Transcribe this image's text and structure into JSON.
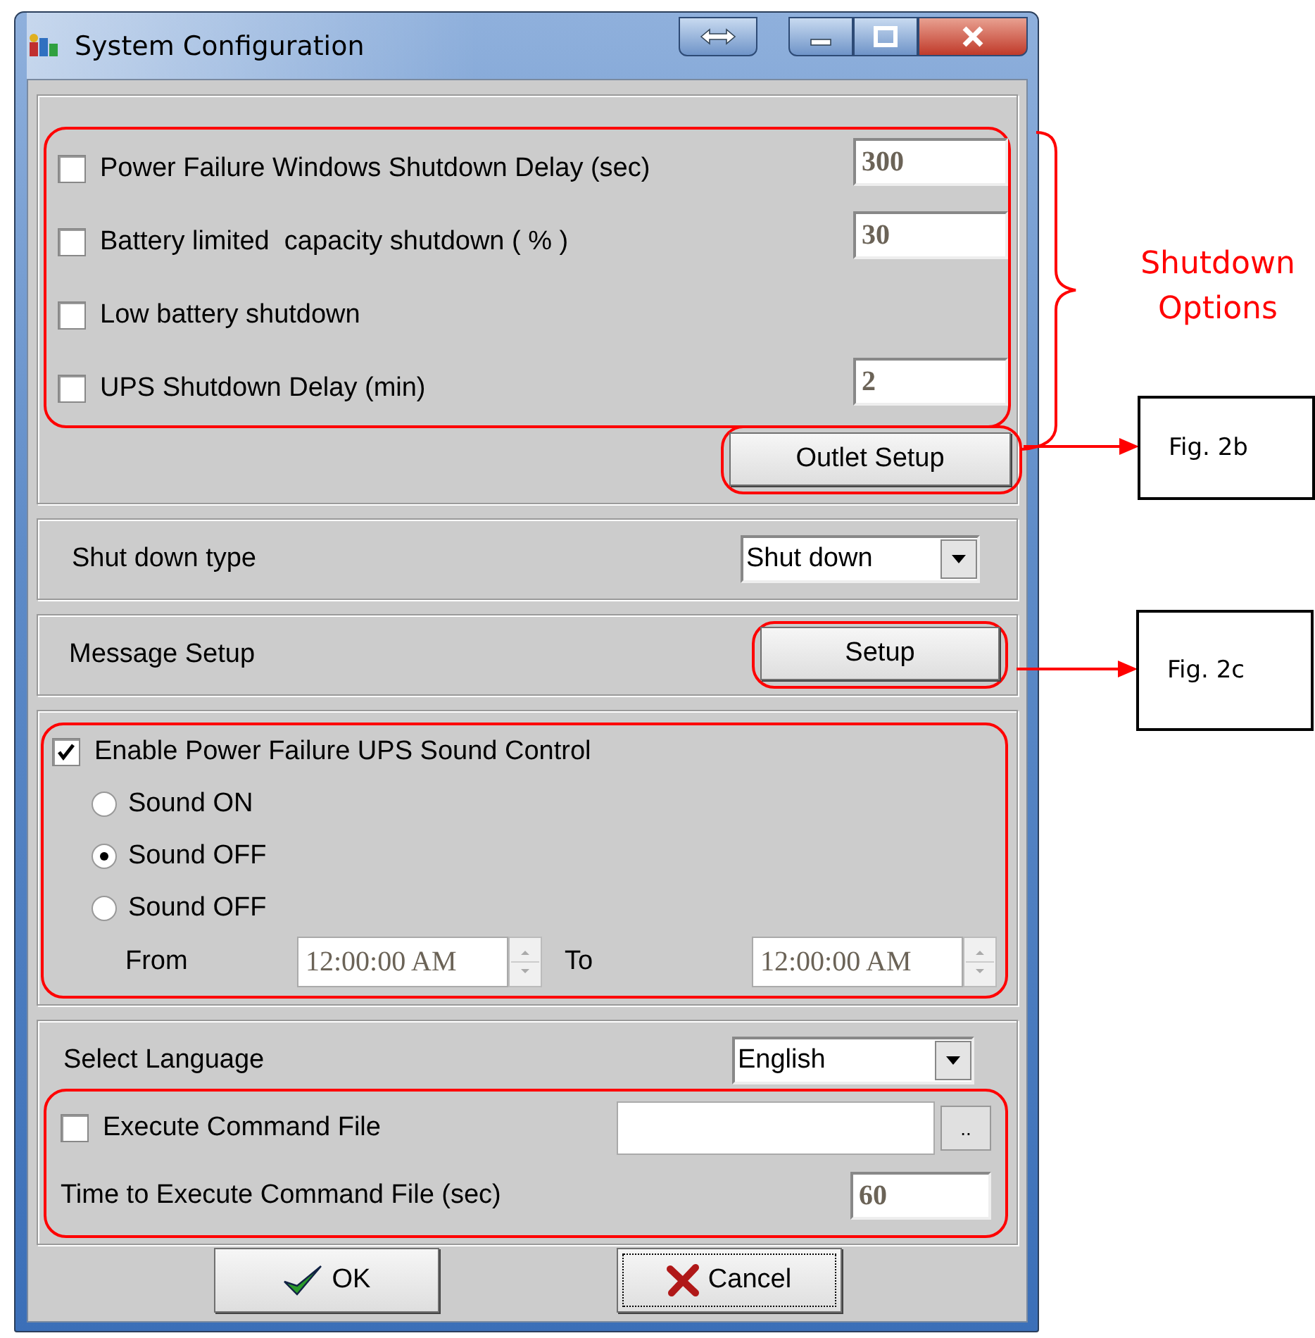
{
  "window": {
    "title": "System Configuration"
  },
  "shutdown_options": [
    {
      "kind": "field",
      "label": "Power Failure Windows Shutdown Delay (sec)",
      "checked": false,
      "value": "300"
    },
    {
      "kind": "field",
      "label": "Battery limited  capacity shutdown ( % )",
      "checked": false,
      "value": "30"
    },
    {
      "kind": "plain",
      "label": "Low battery shutdown",
      "checked": false
    },
    {
      "kind": "field",
      "label": "UPS Shutdown Delay (min)",
      "checked": false,
      "value": "2"
    }
  ],
  "outlet_button": "Outlet Setup",
  "shutdown_type": {
    "label": "Shut down type",
    "value": "Shut down"
  },
  "message_setup": {
    "label": "Message Setup",
    "button": "Setup"
  },
  "sound": {
    "enable": {
      "label": "Enable Power Failure UPS Sound Control",
      "checked": true
    },
    "options": [
      {
        "label": "Sound ON",
        "selected": false
      },
      {
        "label": "Sound OFF",
        "selected": true
      },
      {
        "label": "Sound OFF",
        "selected": false
      }
    ],
    "from_label": "From",
    "from": "12:00:00 AM",
    "to_label": "To",
    "to": "12:00:00 AM"
  },
  "language": {
    "label": "Select Language",
    "value": "English"
  },
  "command": {
    "label": "Execute Command File",
    "checked": false,
    "browse": "..",
    "time_label": "Time to Execute Command File (sec)",
    "time": "60"
  },
  "buttons": [
    {
      "kind": "ok",
      "label": "OK",
      "focused": false
    },
    {
      "kind": "cancel",
      "label": "Cancel",
      "focused": true
    }
  ],
  "annotations": {
    "brace_label": "Shutdown Options",
    "figures": [
      "Fig. 2b",
      "Fig. 2c"
    ]
  }
}
